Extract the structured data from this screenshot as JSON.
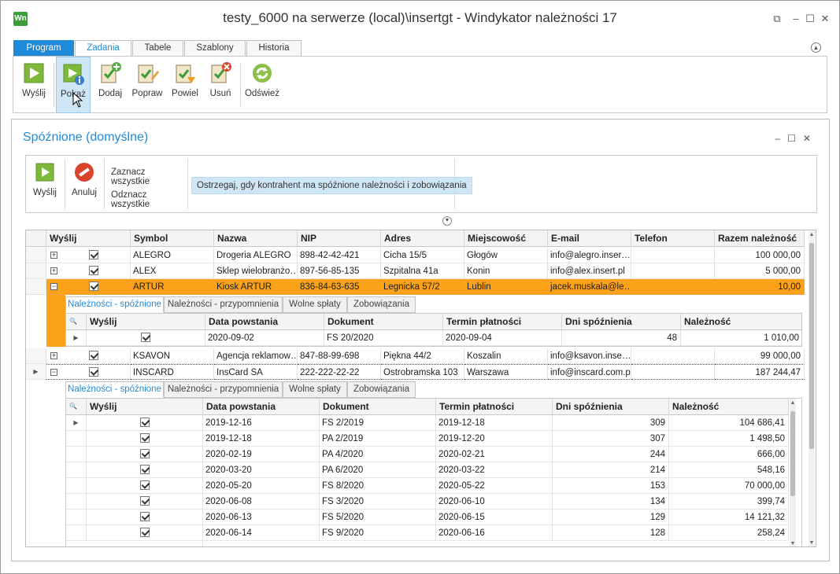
{
  "window": {
    "title": "testy_6000 na serwerze (local)\\insertgt - Windykator należności 17",
    "logo": "Wn",
    "controls": [
      "restore-icon",
      "minimize-icon",
      "maximize-icon",
      "close-icon"
    ]
  },
  "ribbon": {
    "tabs": [
      {
        "label": "Program"
      },
      {
        "label": "Zadania"
      },
      {
        "label": "Tabele"
      },
      {
        "label": "Szablony"
      },
      {
        "label": "Historia"
      }
    ],
    "buttons": [
      {
        "label": "Wyślij",
        "icon": "send-play-icon"
      },
      {
        "label": "Pokaż",
        "icon": "show-info-icon"
      },
      {
        "label": "Dodaj",
        "icon": "add-task-icon"
      },
      {
        "label": "Popraw",
        "icon": "edit-task-icon"
      },
      {
        "label": "Powiel",
        "icon": "duplicate-task-icon"
      },
      {
        "label": "Usuń",
        "icon": "delete-task-icon"
      },
      {
        "label": "Odśwież",
        "icon": "refresh-icon"
      }
    ]
  },
  "panel": {
    "title": "Spóźnione (domyślne)",
    "toolbar": {
      "send_label": "Wyślij",
      "cancel_label": "Anuluj",
      "select_all": "Zaznacz wszystkie",
      "deselect_all": "Odznacz wszystkie",
      "warn_option": "Ostrzegaj, gdy kontrahent ma spóźnione należności i zobowiązania"
    }
  },
  "grid": {
    "headers": [
      "Wyślij",
      "Symbol",
      "Nazwa",
      "NIP",
      "Adres",
      "Miejscowość",
      "E-mail",
      "Telefon",
      "Razem należność"
    ],
    "rows": [
      {
        "symbol": "ALEGRO",
        "nazwa": "Drogeria ALEGRO",
        "nip": "898-42-42-421",
        "adres": "Cicha  15/5",
        "miejscowosc": "Głogów",
        "email": "info@alegro.inser…",
        "telefon": "",
        "razem": "100 000,00",
        "expanded": false
      },
      {
        "symbol": "ALEX",
        "nazwa": "Sklep wielobranżo…",
        "nip": "897-56-85-135",
        "adres": "Szpitalna  41a",
        "miejscowosc": "Konin",
        "email": "info@alex.insert.pl",
        "telefon": "",
        "razem": "5 000,00",
        "expanded": false
      },
      {
        "symbol": "ARTUR",
        "nazwa": "Kiosk ARTUR",
        "nip": "836-84-63-635",
        "adres": "Legnicka  57/2",
        "miejscowosc": "Lublin",
        "email": "jacek.muskala@le…",
        "telefon": "",
        "razem": "10,00",
        "expanded": true
      },
      {
        "symbol": "KSAVON",
        "nazwa": "Agencja reklamow…",
        "nip": "847-88-99-698",
        "adres": "Piękna  44/2",
        "miejscowosc": "Koszalin",
        "email": "info@ksavon.inse…",
        "telefon": "",
        "razem": "99 000,00",
        "expanded": false
      },
      {
        "symbol": "INSCARD",
        "nazwa": "InsCard SA",
        "nip": "222-222-22-22",
        "adres": "Ostrobramska 103",
        "miejscowosc": "Warszawa",
        "email": "info@inscard.com.pl",
        "telefon": "",
        "razem": "187 244,47",
        "expanded": true
      }
    ]
  },
  "detail": {
    "tabs": [
      "Należności - spóźnione",
      "Należności - przypomnienia",
      "Wolne spłaty",
      "Zobowiązania"
    ],
    "headers": [
      "Wyślij",
      "Data powstania",
      "Dokument",
      "Termin płatności",
      "Dni spóźnienia",
      "Należność"
    ],
    "artur_rows": [
      {
        "data": "2020-09-02",
        "dokument": "FS 20/2020",
        "termin": "2020-09-04",
        "dni": "48",
        "naleznosc": "1 010,00"
      }
    ],
    "inscard_rows": [
      {
        "data": "2019-12-16",
        "dokument": "FS 2/2019",
        "termin": "2019-12-18",
        "dni": "309",
        "naleznosc": "104 686,41"
      },
      {
        "data": "2019-12-18",
        "dokument": "PA 2/2019",
        "termin": "2019-12-20",
        "dni": "307",
        "naleznosc": "1 498,50"
      },
      {
        "data": "2020-02-19",
        "dokument": "PA 4/2020",
        "termin": "2020-02-21",
        "dni": "244",
        "naleznosc": "666,00"
      },
      {
        "data": "2020-03-20",
        "dokument": "PA 6/2020",
        "termin": "2020-03-22",
        "dni": "214",
        "naleznosc": "548,16"
      },
      {
        "data": "2020-05-20",
        "dokument": "FS 8/2020",
        "termin": "2020-05-22",
        "dni": "153",
        "naleznosc": "70 000,00"
      },
      {
        "data": "2020-06-08",
        "dokument": "FS 3/2020",
        "termin": "2020-06-10",
        "dni": "134",
        "naleznosc": "399,74"
      },
      {
        "data": "2020-06-13",
        "dokument": "FS 5/2020",
        "termin": "2020-06-15",
        "dni": "129",
        "naleznosc": "14 121,32"
      },
      {
        "data": "2020-06-14",
        "dokument": "FS 9/2020",
        "termin": "2020-06-16",
        "dni": "128",
        "naleznosc": "258,24"
      }
    ]
  },
  "colors": {
    "accent": "#1f8ad8",
    "selected_row": "#fba21a",
    "highlight": "#cfe6f7"
  }
}
